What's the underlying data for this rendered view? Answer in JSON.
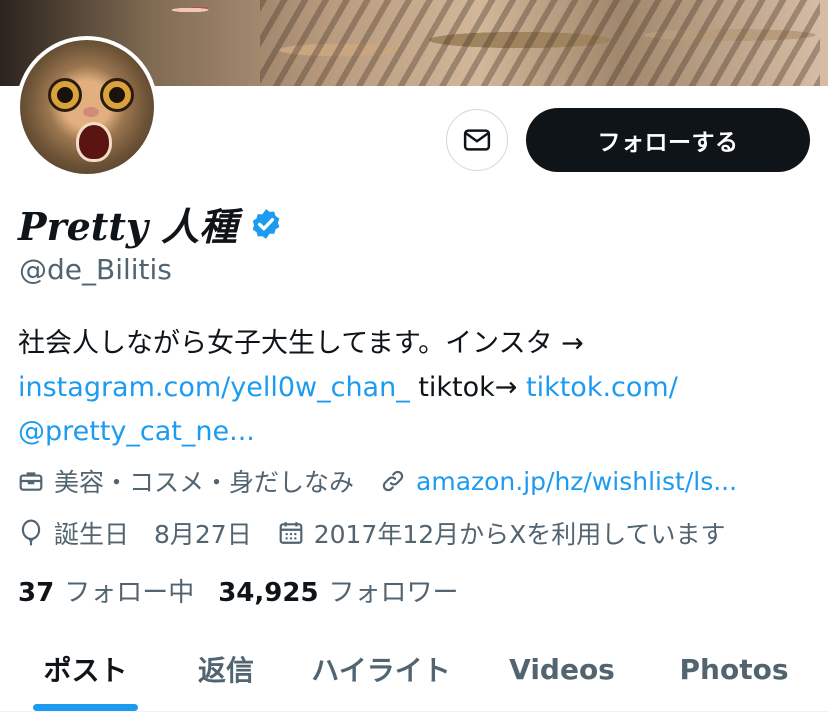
{
  "profile": {
    "display_name": "Pretty 人種",
    "handle": "@de_Bilitis",
    "follow_label": "フォローする",
    "verified_color": "#1d9bf0",
    "bio": {
      "text1": "社会人しながら女子大生してます。インスタ →",
      "link1": "instagram.com/yell0w_chan_",
      "text2": "tiktok→",
      "link2": "tiktok.com/",
      "link2b": "@pretty_cat_ne..."
    },
    "category": "美容・コスメ・身だしなみ",
    "website": "amazon.jp/hz/wishlist/ls...",
    "birthday": "誕生日　8月27日",
    "joined": "2017年12月からXを利用しています",
    "following_count": "37",
    "following_label": "フォロー中",
    "followers_count": "34,925",
    "followers_label": "フォロワー"
  },
  "tabs": [
    {
      "label": "ポスト"
    },
    {
      "label": "返信"
    },
    {
      "label": "ハイライト"
    },
    {
      "label": "Videos"
    },
    {
      "label": "Photos"
    }
  ],
  "icons": {
    "message": "envelope-icon",
    "verified": "verified-badge-icon",
    "category": "briefcase-icon",
    "website": "link-icon",
    "birthday": "balloon-icon",
    "joined": "calendar-icon"
  }
}
